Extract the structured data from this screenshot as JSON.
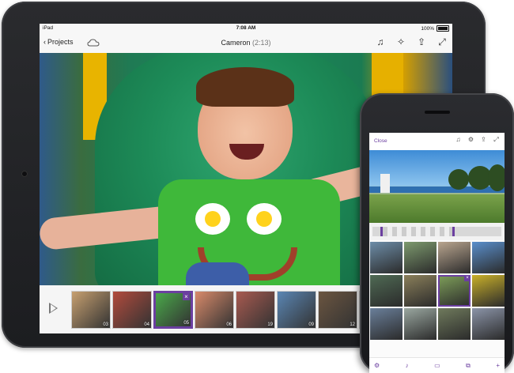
{
  "tablet": {
    "status": {
      "carrier": "iPad",
      "time": "7:08 AM",
      "battery": "100%"
    },
    "nav": {
      "back_label": "Projects",
      "title": "Cameron",
      "duration": "(2:13)"
    },
    "icons": [
      "music-icon",
      "magic-wand-icon",
      "share-icon",
      "fullscreen-icon"
    ],
    "timeline": {
      "thumbs": [
        {
          "num": "03",
          "color": "#c7a070"
        },
        {
          "num": "04",
          "color": "#b24b3d"
        },
        {
          "num": "05",
          "color": "#4aa84a",
          "selected": true
        },
        {
          "num": "06",
          "color": "#d98a6a"
        },
        {
          "num": "19",
          "color": "#a85a50"
        },
        {
          "num": "09",
          "color": "#5a86b4"
        },
        {
          "num": "12",
          "color": "#6b5540"
        },
        {
          "num": "",
          "color": "#c26e55"
        }
      ]
    }
  },
  "phone": {
    "close_label": "Close",
    "icons": [
      "music-icon",
      "settings-icon",
      "share-icon",
      "fullscreen-icon"
    ],
    "grid": [
      {
        "color": "#6d8da8"
      },
      {
        "color": "#7d9a6e"
      },
      {
        "color": "#b9a58f"
      },
      {
        "color": "#5a8fcc"
      },
      {
        "color": "#4f6a54"
      },
      {
        "color": "#8a7f5a"
      },
      {
        "color": "#7fa05a",
        "selected": true
      },
      {
        "color": "#c9b02a"
      },
      {
        "color": "#6a7f9a"
      },
      {
        "color": "#9aa7a0"
      },
      {
        "color": "#6f7a5c"
      },
      {
        "color": "#8b94a8"
      }
    ],
    "bottom_icons": [
      "theme-icon",
      "audio-icon",
      "car-icon",
      "duplicate-icon",
      "add-icon"
    ]
  }
}
